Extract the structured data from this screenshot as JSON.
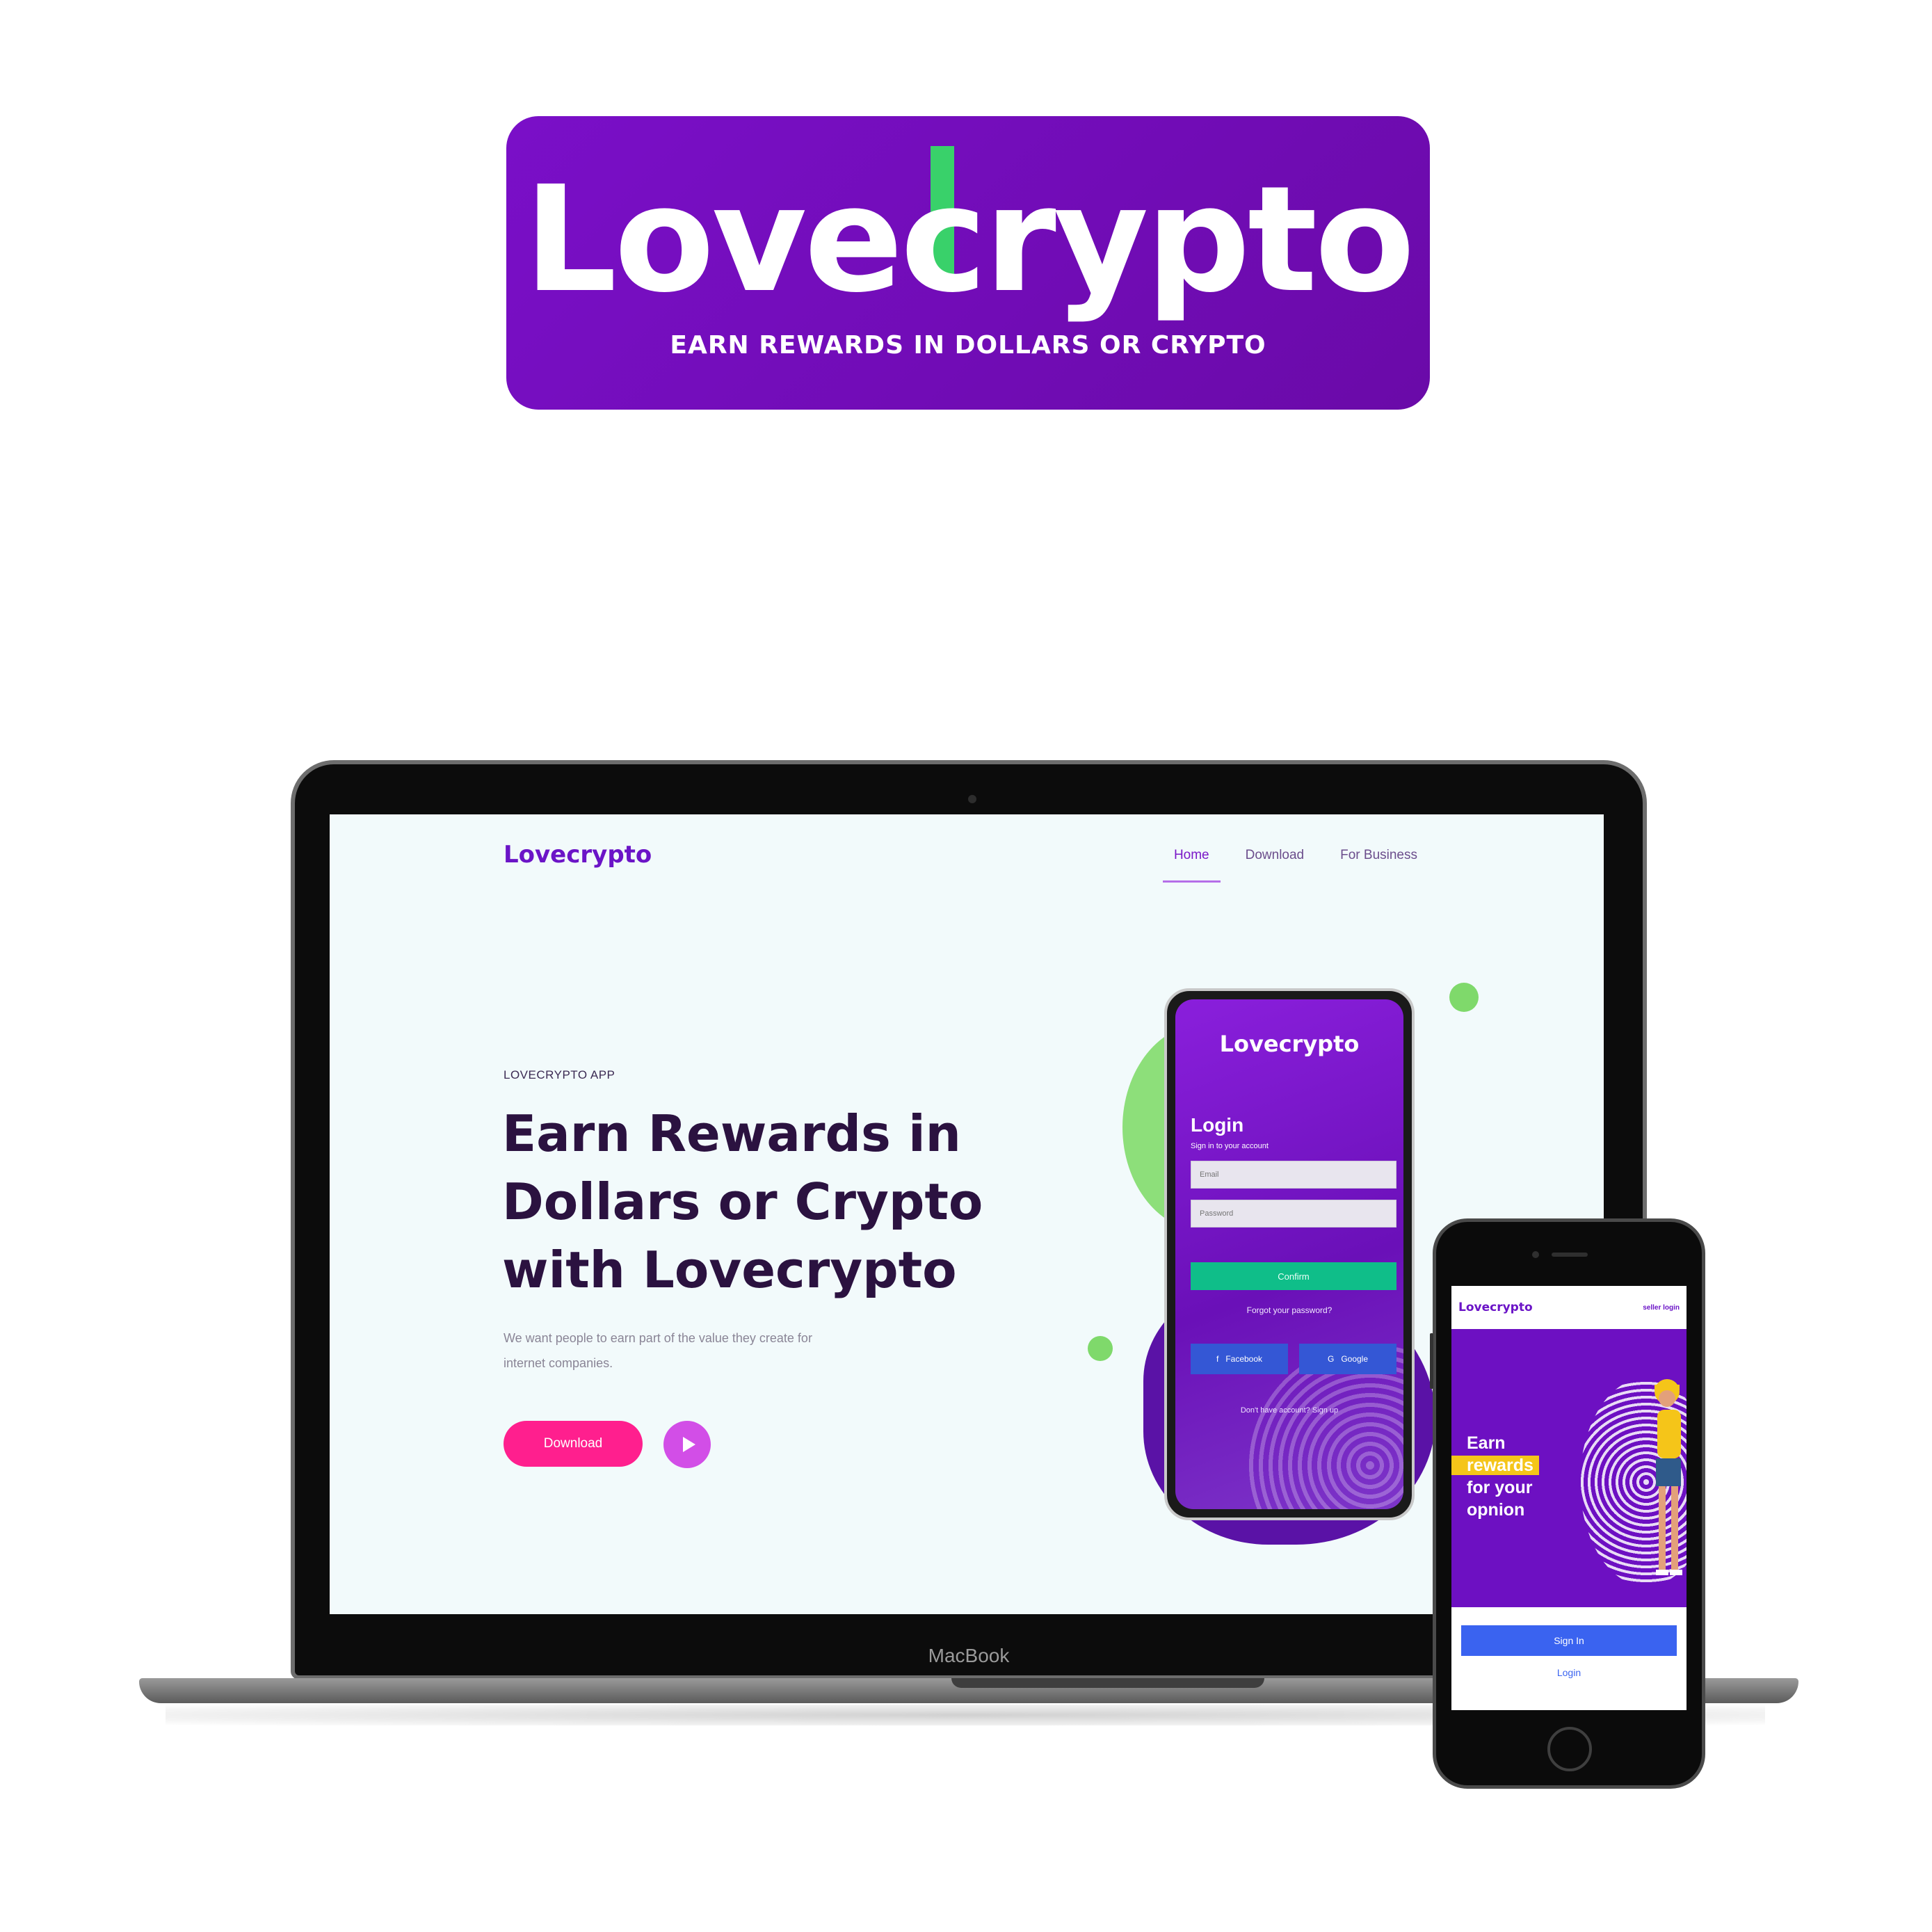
{
  "banner": {
    "logo_prefix": "Love",
    "logo_accent": "c",
    "logo_suffix": "rypto",
    "tagline": "EARN REWARDS IN DOLLARS OR CRYPTO",
    "brand_color": "#7a0fc8",
    "accent_color": "#39d16a"
  },
  "laptop": {
    "label": "MacBook"
  },
  "site": {
    "logo": "Lovecrypto",
    "nav": [
      {
        "label": "Home",
        "active": true
      },
      {
        "label": "Download",
        "active": false
      },
      {
        "label": "For Business",
        "active": false
      }
    ],
    "eyebrow": "LOVECRYPTO APP",
    "hero_title": "Earn Rewards in Dollars or Crypto with Lovecrypto",
    "hero_text": "We want people to earn part of the value they create for internet companies.",
    "download_button": "Download",
    "play_icon": "play-icon"
  },
  "login_phone": {
    "logo": "Lovecrypto",
    "title": "Login",
    "subtitle": "Sign in to your account",
    "email_placeholder": "Email",
    "password_placeholder": "Password",
    "confirm_button": "Confirm",
    "forgot": "Forgot your password?",
    "facebook_button": "Facebook",
    "google_button": "Google",
    "signup": "Don't have account? Sign up"
  },
  "iphone": {
    "logo": "Lovecrypto",
    "header_link": "seller login",
    "hero_line1": "Earn",
    "hero_highlight": "rewards",
    "hero_line3": "for your",
    "hero_line4": "opnion",
    "signin_button": "Sign In",
    "login_link": "Login"
  }
}
